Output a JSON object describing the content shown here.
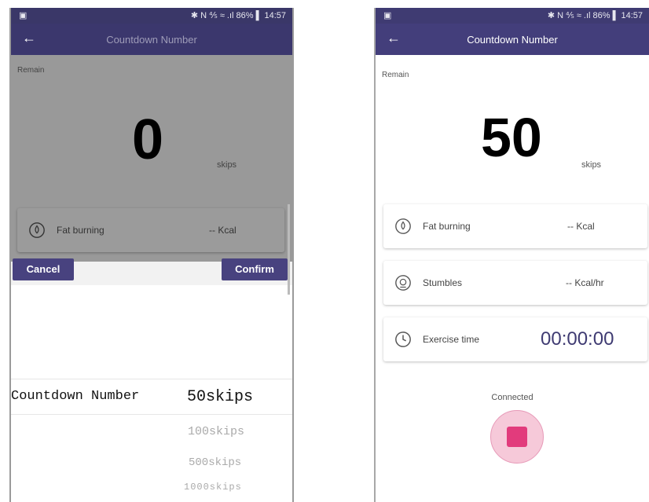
{
  "left": {
    "status": {
      "left_icon": "image-icon",
      "right": "✱ N ⅘ ≈ .ıl 86% ▌ 14:57"
    },
    "title": "Countdown Number",
    "remain_label": "Remain",
    "count": "0",
    "unit": "skips",
    "fat_card": {
      "label": "Fat burning",
      "value": "-- Kcal"
    },
    "cancel": "Cancel",
    "confirm": "Confirm",
    "picker_label": "Countdown Number",
    "picker_selected": "50skips",
    "picker_options": [
      "100skips",
      "500skips",
      "1000skips"
    ]
  },
  "right": {
    "status": {
      "left_icon": "image-icon",
      "right": "✱ N ⅘ ≈ .ıl 86% ▌ 14:57"
    },
    "title": "Countdown Number",
    "remain_label": "Remain",
    "count": "50",
    "unit": "skips",
    "fat_card": {
      "label": "Fat burning",
      "value": "-- Kcal"
    },
    "stumbles_card": {
      "label": "Stumbles",
      "value": "-- Kcal/hr"
    },
    "time_card": {
      "label": "Exercise time",
      "value": "00:00:00"
    },
    "connection": "Connected"
  },
  "colors": {
    "header": "#433e7b",
    "accent": "#e23b7c",
    "button_ring": "#f6c9d9",
    "overlay": "#999999"
  }
}
